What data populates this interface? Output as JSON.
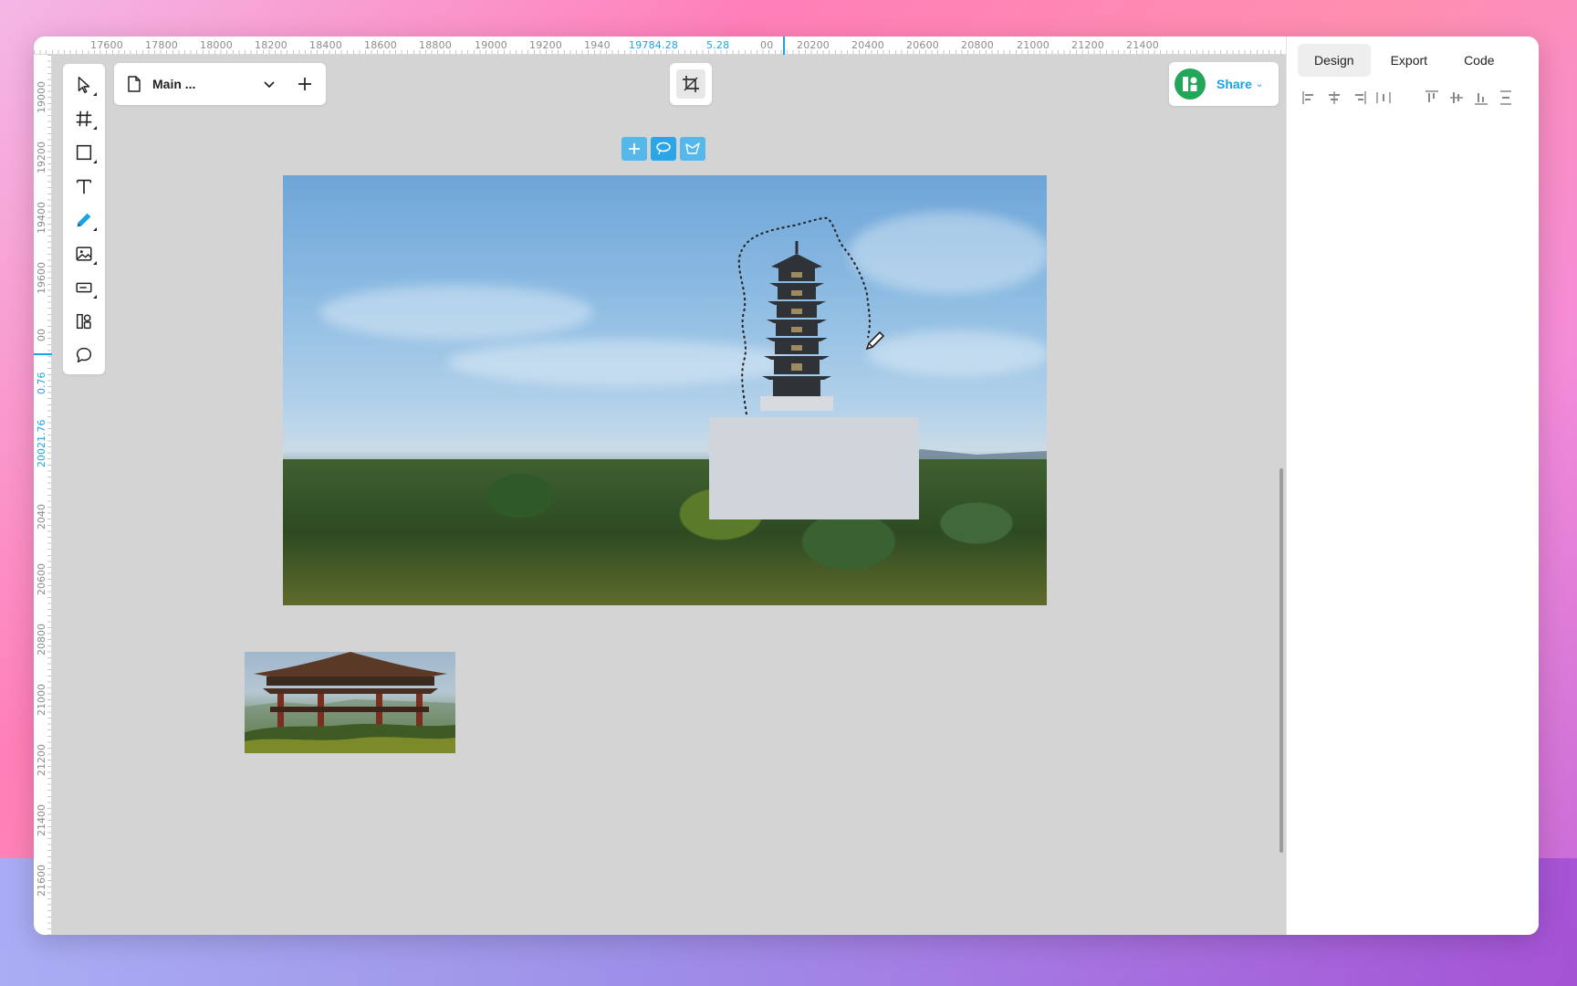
{
  "ruler_top": {
    "labels": [
      "17600",
      "17800",
      "18000",
      "18200",
      "18400",
      "18600",
      "18800",
      "19000",
      "19200",
      "1940",
      "19784.28",
      "5.28",
      "00",
      "20200",
      "20400",
      "20600",
      "20800",
      "21000",
      "21200",
      "21400"
    ],
    "highlight": [
      "19784.28",
      "5.28"
    ]
  },
  "ruler_left": {
    "labels": [
      "19000",
      "19200",
      "19400",
      "19600",
      "00",
      "0.76",
      "20021.76",
      "2040",
      "20600",
      "20800",
      "21000",
      "21200",
      "21400",
      "21600"
    ],
    "highlight": [
      "0.76",
      "20021.76"
    ]
  },
  "tools": [
    "select-tool",
    "frame-tool",
    "rectangle-tool",
    "text-tool",
    "pen-tool",
    "image-tool",
    "input-tool",
    "component-tool",
    "comment-tool"
  ],
  "page_selector": {
    "name": "Main ..."
  },
  "share": {
    "label": "Share",
    "caret": "⌄"
  },
  "panel": {
    "tabs": [
      "Design",
      "Export",
      "Code"
    ],
    "active_tab": "Design"
  },
  "colors": {
    "accent": "#1aa3e6",
    "avatar": "#22a65a",
    "canvas": "#d4d4d4"
  }
}
